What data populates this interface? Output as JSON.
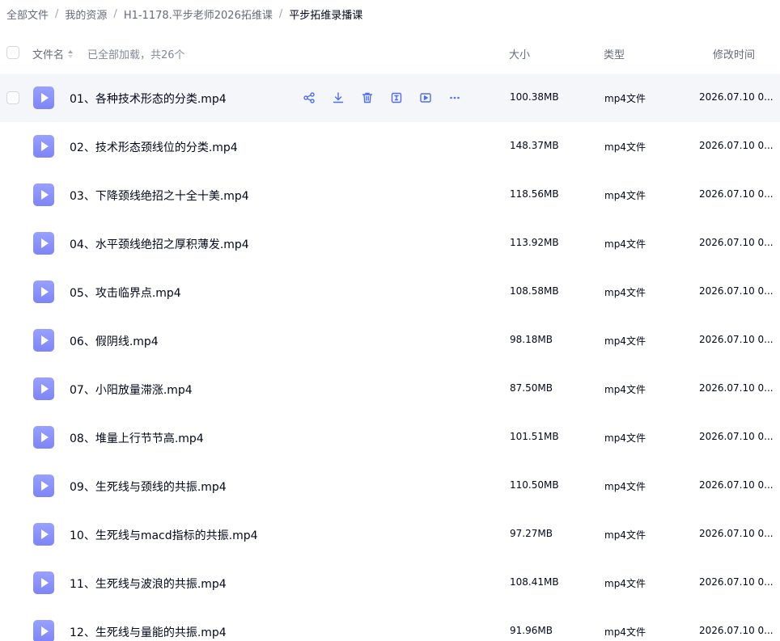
{
  "breadcrumb": [
    {
      "label": "全部文件"
    },
    {
      "label": "我的资源"
    },
    {
      "label": "H1-1178.平步老师2026拓维课"
    },
    {
      "label": "平步拓维录播课"
    }
  ],
  "breadcrumb_separator": "/",
  "header": {
    "name_label": "文件名",
    "loaded_text": "已全部加载，共26个",
    "size_label": "大小",
    "type_label": "类型",
    "time_label": "修改时间"
  },
  "row_actions": [
    "share-icon",
    "download-icon",
    "trash-icon",
    "rename-icon",
    "play-icon",
    "more-icon"
  ],
  "colors": {
    "accent": "#4e6ef2",
    "file_icon": "#8c92fa",
    "hover_row": "#f5f6fa"
  },
  "files": [
    {
      "name": "01、各种技术形态的分类.mp4",
      "size": "100.38MB",
      "type": "mp4文件",
      "time": "2026.07.10 0..."
    },
    {
      "name": "02、技术形态颈线位的分类.mp4",
      "size": "148.37MB",
      "type": "mp4文件",
      "time": "2026.07.10 0..."
    },
    {
      "name": "03、下降颈线绝招之十全十美.mp4",
      "size": "118.56MB",
      "type": "mp4文件",
      "time": "2026.07.10 0..."
    },
    {
      "name": "04、水平颈线绝招之厚积薄发.mp4",
      "size": "113.92MB",
      "type": "mp4文件",
      "time": "2026.07.10 0..."
    },
    {
      "name": "05、攻击临界点.mp4",
      "size": "108.58MB",
      "type": "mp4文件",
      "time": "2026.07.10 0..."
    },
    {
      "name": "06、假阴线.mp4",
      "size": "98.18MB",
      "type": "mp4文件",
      "time": "2026.07.10 0..."
    },
    {
      "name": "07、小阳放量滞涨.mp4",
      "size": "87.50MB",
      "type": "mp4文件",
      "time": "2026.07.10 0..."
    },
    {
      "name": "08、堆量上行节节高.mp4",
      "size": "101.51MB",
      "type": "mp4文件",
      "time": "2026.07.10 0..."
    },
    {
      "name": "09、生死线与颈线的共振.mp4",
      "size": "110.50MB",
      "type": "mp4文件",
      "time": "2026.07.10 0..."
    },
    {
      "name": "10、生死线与macd指标的共振.mp4",
      "size": "97.27MB",
      "type": "mp4文件",
      "time": "2026.07.10 0..."
    },
    {
      "name": "11、生死线与波浪的共振.mp4",
      "size": "108.41MB",
      "type": "mp4文件",
      "time": "2026.07.10 0..."
    },
    {
      "name": "12、生死线与量能的共振.mp4",
      "size": "91.96MB",
      "type": "mp4文件",
      "time": "2026.07.10 0..."
    }
  ]
}
